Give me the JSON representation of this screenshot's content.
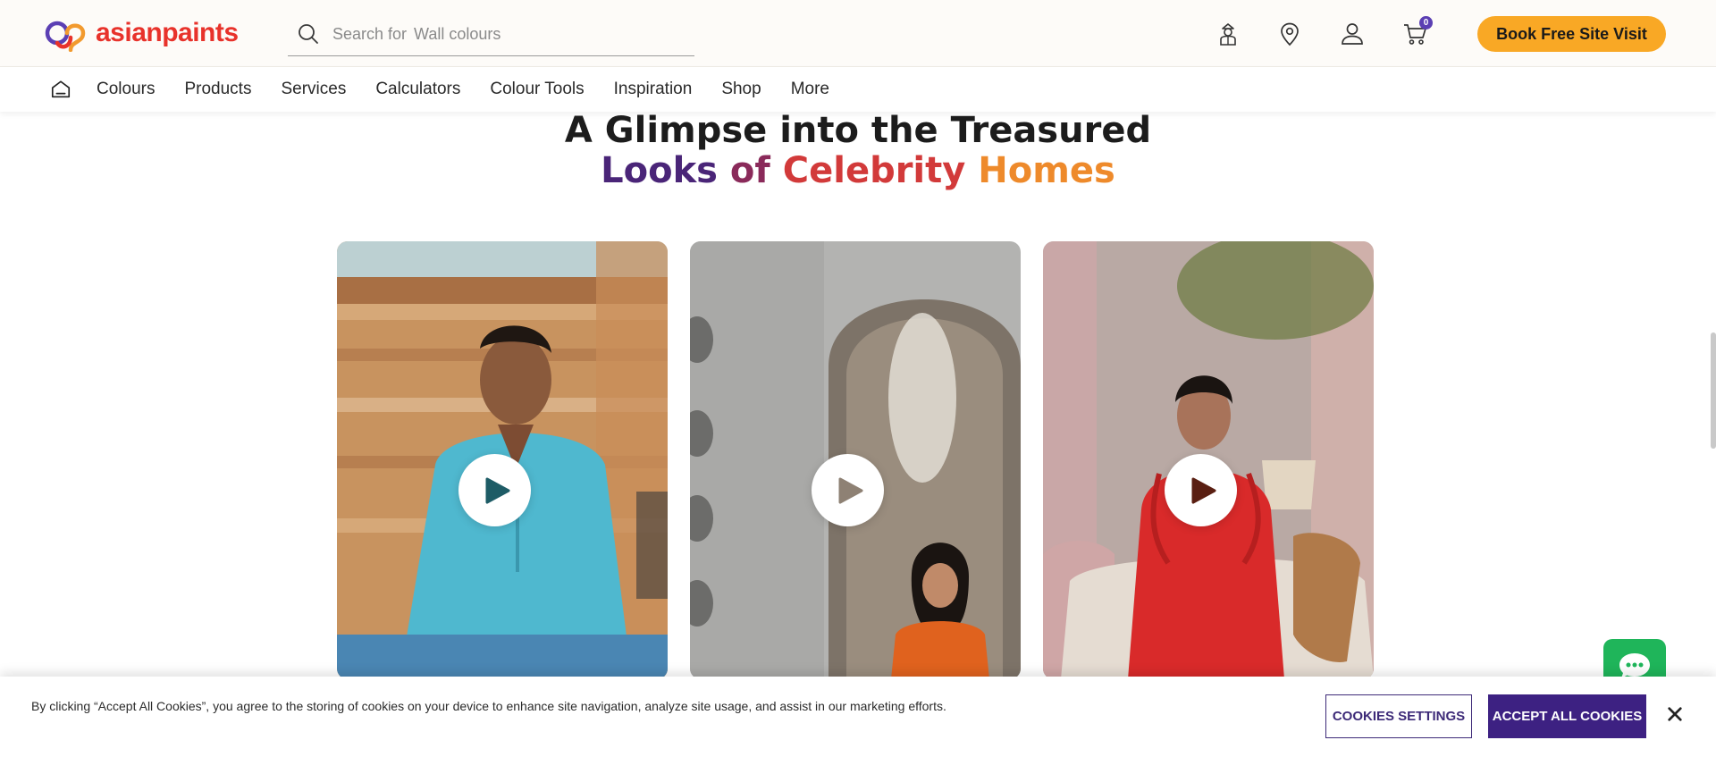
{
  "brand": {
    "name": "asianpaints",
    "color": "#e8322b"
  },
  "search": {
    "prefix": "Search for",
    "placeholder": "Wall colours"
  },
  "header_icons": [
    "painter-icon",
    "location-pin-icon",
    "user-icon",
    "cart-icon"
  ],
  "cart": {
    "count": "0"
  },
  "cta": {
    "book_label": "Book Free Site Visit",
    "color": "#f9a825"
  },
  "nav": {
    "items": [
      "Colours",
      "Products",
      "Services",
      "Calculators",
      "Colour Tools",
      "Inspiration",
      "Shop",
      "More"
    ]
  },
  "heading": {
    "line1": "A Glimpse into the Treasured",
    "w1": "Looks",
    "w2": "of",
    "w3": "Celebrity",
    "w4": "Homes"
  },
  "videos": [
    {
      "name": "celebrity-video-1",
      "play": "play-icon"
    },
    {
      "name": "celebrity-video-2",
      "play": "play-icon"
    },
    {
      "name": "celebrity-video-3",
      "play": "play-icon"
    }
  ],
  "cookie": {
    "text": "By clicking “Accept All Cookies”, you agree to the storing of cookies on your device to enhance site navigation, analyze site usage, and assist in our marketing efforts.",
    "settings_label": "COOKIES SETTINGS",
    "accept_label": "ACCEPT ALL COOKIES",
    "accent": "#3d2182"
  },
  "chat": {
    "icon": "chat-bubble-icon",
    "color": "#1fb55a"
  }
}
